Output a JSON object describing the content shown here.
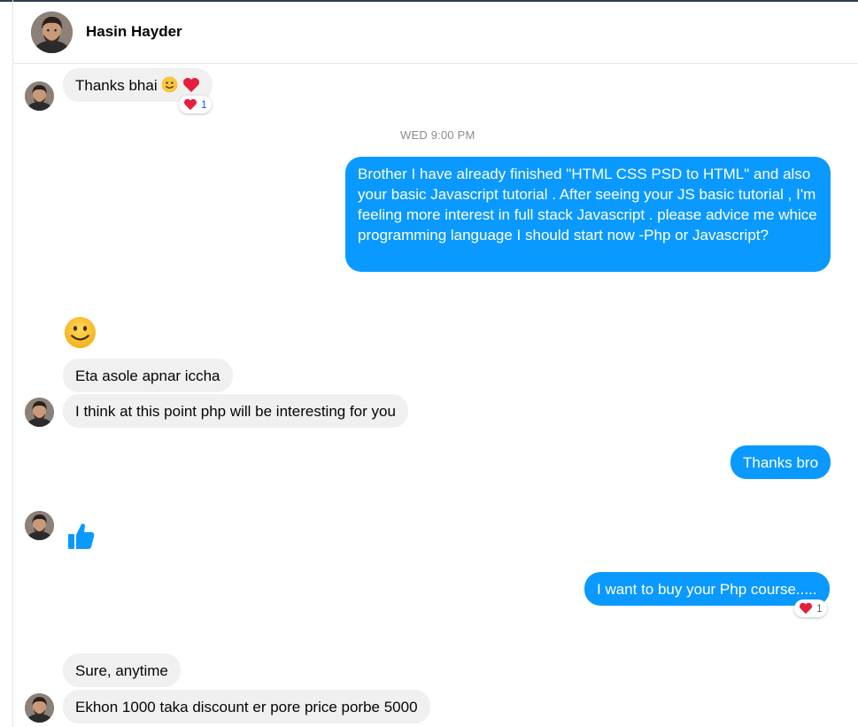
{
  "header": {
    "contact_name": "Hasin Hayder",
    "avatar_icon": "profile-photo"
  },
  "colors": {
    "outgoing_bubble": "#0a99ff",
    "incoming_bubble": "#f0f0f0",
    "reaction_heart": "#e41e3f"
  },
  "timestamp": "WED 9:00 PM",
  "messages": [
    {
      "side": "incoming",
      "text": "Thanks bhai",
      "emojis": [
        "slightly-smiling-face-icon",
        "red-heart-icon"
      ],
      "reaction": {
        "icon": "red-heart-icon",
        "count": "1"
      }
    },
    {
      "side": "outgoing",
      "text": "Brother I have already finished \"HTML CSS PSD to HTML\" and also your basic Javascript  tutorial . After seeing your JS basic tutorial , I'm feeling more interest in full stack Javascript . please advice me whice programming language I should start now -Php or Javascript?"
    },
    {
      "side": "incoming",
      "type": "emoji",
      "icon": "slightly-smiling-face-icon"
    },
    {
      "side": "incoming",
      "text": "Eta asole apnar iccha"
    },
    {
      "side": "incoming",
      "text": "I think at this point php will be interesting for you"
    },
    {
      "side": "outgoing",
      "text": "Thanks bro"
    },
    {
      "side": "incoming",
      "type": "like",
      "icon": "thumbs-up-icon"
    },
    {
      "side": "outgoing",
      "text": "I want to buy your Php course.....",
      "reaction": {
        "icon": "red-heart-icon",
        "count": "1"
      }
    },
    {
      "side": "incoming",
      "text": "Sure, anytime"
    },
    {
      "side": "incoming",
      "text": "Ekhon 1000 taka discount er pore price porbe 5000"
    }
  ]
}
